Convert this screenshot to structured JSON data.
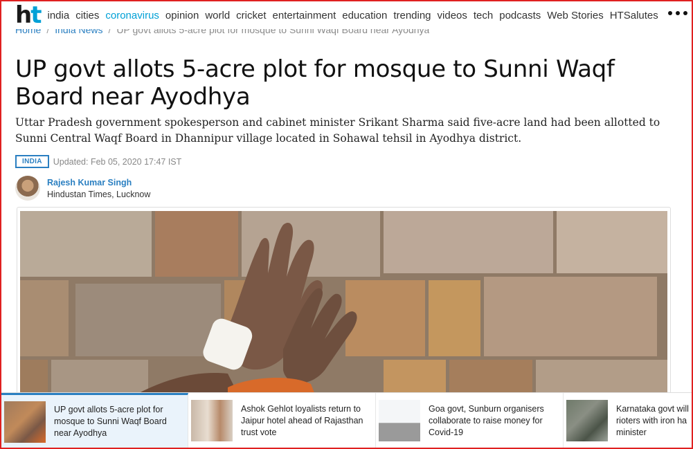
{
  "logo": {
    "h": "h",
    "t": "t"
  },
  "nav": {
    "items": [
      "india",
      "cities",
      "coronavirus",
      "opinion",
      "world",
      "cricket",
      "entertainment",
      "education",
      "trending",
      "videos",
      "tech",
      "podcasts",
      "Web Stories",
      "HTSalutes"
    ],
    "highlighted": "coronavirus"
  },
  "breadcrumb": {
    "home": "Home",
    "section": "India News",
    "current": "UP govt allots 5-acre plot for mosque to Sunni Waqf Board near Ayodhya"
  },
  "article": {
    "headline": "UP govt allots 5-acre plot for mosque to Sunni Waqf Board near Ayodhya",
    "summary": "Uttar Pradesh government spokesperson and cabinet minister Srikant Sharma said five-acre land had been allotted to Sunni Central Waqf Board in Dhannipur village located in Sohawal tehsil in Ayodhya district.",
    "section_badge": "INDIA",
    "updated": "Updated: Feb 05, 2020 17:47 IST",
    "author_name": "Rajesh Kumar Singh",
    "author_org": "Hindustan Times, Lucknow"
  },
  "related": [
    {
      "title": "UP govt allots 5-acre plot for mosque to Sunni Waqf Board near Ayodhya",
      "active": true
    },
    {
      "title": "Ashok Gehlot loyalists return to Jaipur hotel ahead of Rajasthan trust vote",
      "active": false
    },
    {
      "title": "Goa govt, Sunburn organisers collaborate to raise money for Covid-19",
      "active": false
    },
    {
      "title": "Karnataka govt will rioters with iron ha minister",
      "active": false
    }
  ],
  "colors": {
    "brand": "#00a0d6",
    "link": "#2a7fc1",
    "border": "#e02020"
  }
}
